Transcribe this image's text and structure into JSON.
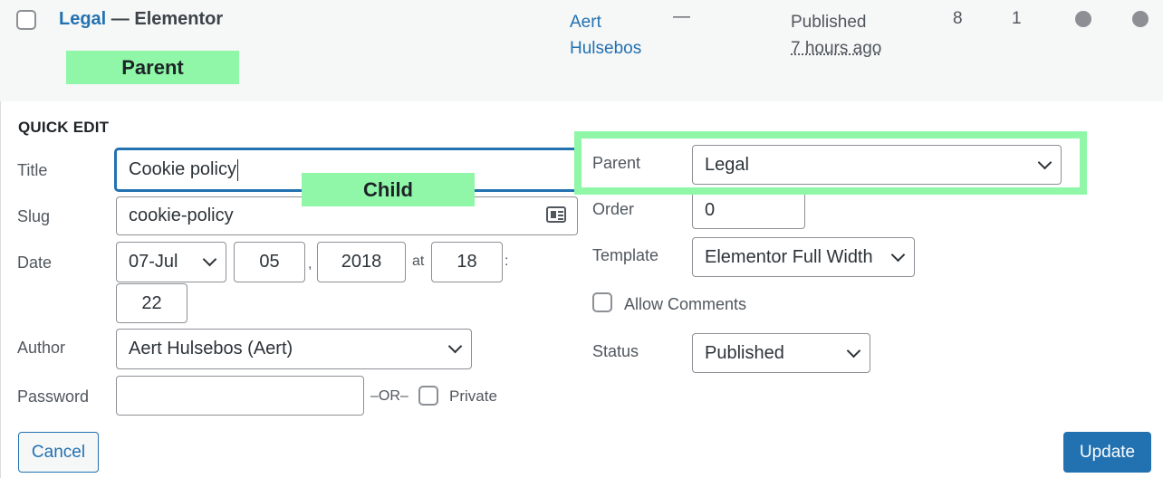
{
  "row": {
    "title_link": "Legal",
    "title_sep": " — Elementor",
    "author_line1": "Aert",
    "author_line2": "Hulsebos",
    "dash": "—",
    "status": "Published",
    "time": "7 hours ago",
    "count1": "8",
    "count2": "1"
  },
  "annotations": {
    "parent": "Parent",
    "child": "Child"
  },
  "quick_edit": {
    "heading": "QUICK EDIT",
    "title_label": "Title",
    "title_value": "Cookie policy",
    "slug_label": "Slug",
    "slug_value": "cookie-policy",
    "date_label": "Date",
    "month_value": "07-Jul",
    "day_value": "05",
    "comma": ",",
    "year_value": "2018",
    "at": "at",
    "hour_value": "18",
    "colon": ":",
    "minute_value": "22",
    "author_label": "Author",
    "author_value": "Aert Hulsebos (Aert)",
    "password_label": "Password",
    "password_value": "",
    "or_text": "–OR–",
    "private_label": "Private",
    "parent_label": "Parent",
    "parent_value": "Legal",
    "order_label": "Order",
    "order_value": "0",
    "template_label": "Template",
    "template_value": "Elementor Full Width",
    "allow_comments_label": "Allow Comments",
    "status_label": "Status",
    "status_value": "Published"
  },
  "buttons": {
    "cancel": "Cancel",
    "update": "Update"
  },
  "colors": {
    "link": "#2271b1",
    "highlight": "#8ff7a7",
    "button_primary": "#2271b1"
  }
}
